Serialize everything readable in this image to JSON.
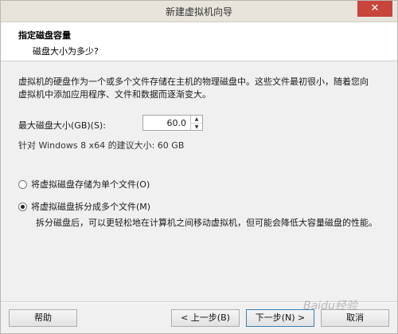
{
  "window": {
    "title": "新建虚拟机向导",
    "close_label": "✕"
  },
  "header": {
    "title": "指定磁盘容量",
    "subtitle": "磁盘大小为多少?"
  },
  "description": "虚拟机的硬盘作为一个或多个文件存储在主机的物理磁盘中。这些文件最初很小，随着您向虚拟机中添加应用程序、文件和数据而逐渐变大。",
  "disk_size": {
    "label": "最大磁盘大小(GB)(S):",
    "value": "60.0",
    "recommendation": "针对 Windows 8 x64 的建议大小: 60 GB"
  },
  "options": {
    "single_file": {
      "label": "将虚拟磁盘存储为单个文件(O)",
      "checked": false
    },
    "multiple_files": {
      "label": "将虚拟磁盘拆分成多个文件(M)",
      "checked": true
    },
    "split_description": "拆分磁盘后，可以更轻松地在计算机之间移动虚拟机，但可能会降低大容量磁盘的性能。"
  },
  "buttons": {
    "help": "帮助",
    "back": "< 上一步(B)",
    "next": "下一步(N) >",
    "cancel": "取消"
  },
  "watermark": "Baidu经验"
}
